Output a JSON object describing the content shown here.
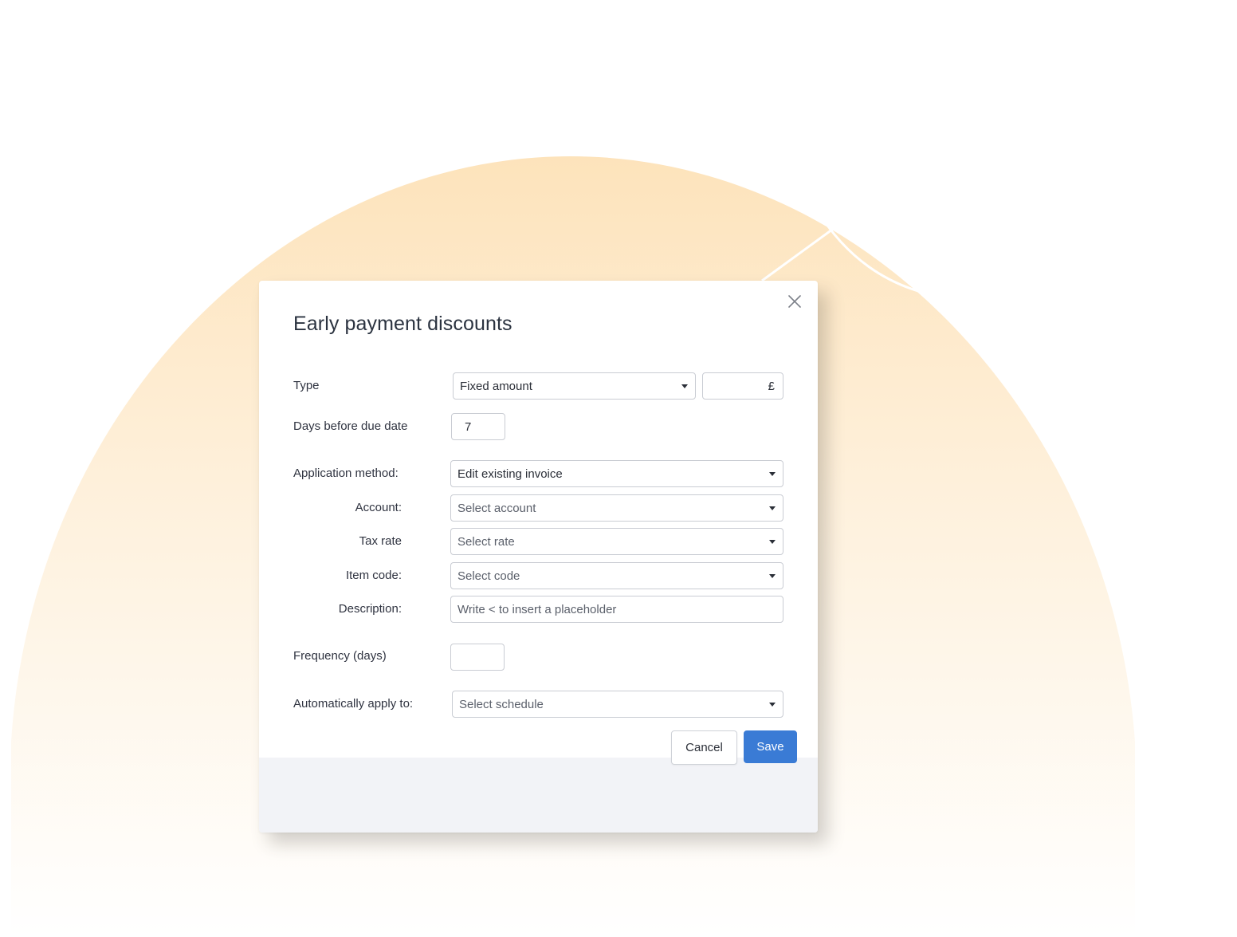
{
  "modal": {
    "title": "Early payment discounts",
    "close_label": "close"
  },
  "form": {
    "type": {
      "label": "Type",
      "selected": "Fixed amount",
      "currency_symbol": "£",
      "amount_value": ""
    },
    "days_before_due": {
      "label": "Days before due date",
      "value": "7"
    },
    "application_method": {
      "label": "Application method:",
      "selected": "Edit existing invoice"
    },
    "account": {
      "label": "Account:",
      "placeholder": "Select account"
    },
    "tax_rate": {
      "label": "Tax rate",
      "placeholder": "Select rate"
    },
    "item_code": {
      "label": "Item code:",
      "placeholder": "Select code"
    },
    "description": {
      "label": "Description:",
      "placeholder": "Write < to insert a placeholder"
    },
    "frequency": {
      "label": "Frequency (days)",
      "value": ""
    },
    "auto_apply": {
      "label": "Automatically apply to:",
      "placeholder": "Select schedule"
    }
  },
  "actions": {
    "cancel_label": "Cancel",
    "save_label": "Save"
  },
  "colors": {
    "primary": "#3a7bd5",
    "background_glow": "#fde6c2",
    "footer_band": "#f2f3f7"
  }
}
